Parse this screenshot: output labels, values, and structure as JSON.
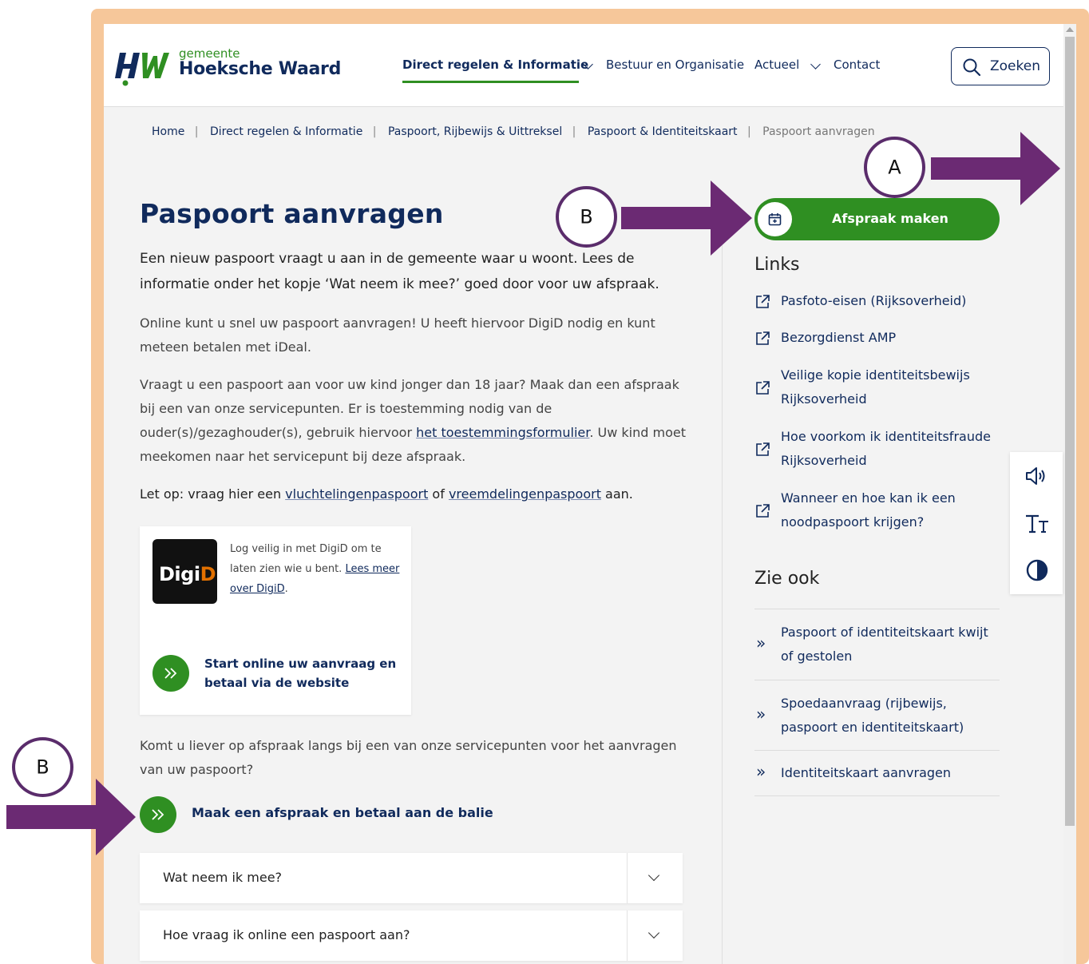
{
  "logo": {
    "small": "gemeente",
    "big": "Hoeksche Waard"
  },
  "nav": {
    "items": [
      {
        "label": "Direct regelen & Informatie"
      },
      {
        "label": "Bestuur en Organisatie"
      },
      {
        "label": "Actueel"
      },
      {
        "label": "Contact"
      }
    ],
    "search_label": "Zoeken"
  },
  "breadcrumb": [
    "Home",
    "Direct regelen & Informatie",
    "Paspoort, Rijbewijs & Uittreksel",
    "Paspoort & Identiteitskaart",
    "Paspoort aanvragen"
  ],
  "page_title": "Paspoort aanvragen",
  "intro": "Een nieuw paspoort vraagt u aan in de gemeente waar u woont. Lees de informatie onder het kopje ‘Wat neem ik mee?’ goed door voor uw afspraak.",
  "p1": "Online kunt u snel uw paspoort aanvragen! U heeft hiervoor DigiD nodig en kunt meteen betalen met iDeal.",
  "p2": {
    "before": "Vraagt u een paspoort aan voor uw kind jonger dan 18 jaar? Maak dan een afspraak bij een van onze servicepunten. Er is toestemming nodig van de ouder(s)/gezaghouder(s), gebruik hiervoor ",
    "link": "het toestemmingsformulier",
    "after": ". Uw kind moet meekomen naar het servicepunt bij deze afspraak."
  },
  "p3": {
    "before": "Let op: vraag hier een ",
    "link1": "vluchtelingenpaspoort",
    "mid": " of ",
    "link2": "vreemdelingenpaspoort",
    "after": " aan."
  },
  "digid": {
    "logo_a": "Digi",
    "logo_b": "D",
    "text": "Log veilig in met DigiD om te laten zien wie u bent. ",
    "link": "Lees meer over DigiD",
    "text_end": ".",
    "start": "Start online uw aanvraag en betaal via de website"
  },
  "p4": "Komt u liever op afspraak langs bij een van onze servicepunten voor het aanvragen van uw paspoort?",
  "afspraak_link": "Maak een afspraak en betaal aan de balie",
  "accordions": [
    "Wat neem ik mee?",
    "Hoe vraag ik online een paspoort aan?"
  ],
  "sidebar": {
    "button": "Afspraak maken",
    "links_heading": "Links",
    "links": [
      [
        "Pasfoto-eisen (Rijksoverheid)"
      ],
      [
        "Bezorgdienst AMP"
      ],
      [
        "Veilige kopie identiteitsbewijs",
        "Rijksoverheid"
      ],
      [
        "Hoe voorkom ik identiteitsfraude",
        "Rijksoverheid"
      ],
      [
        "Wanneer en hoe kan ik een",
        "noodpaspoort krijgen?"
      ]
    ],
    "see_heading": "Zie ook",
    "see": [
      [
        "Paspoort of identiteitskaart kwijt",
        "of gestolen"
      ],
      [
        "Spoedaanvraag (rijbewijs,",
        "paspoort en identiteitskaart)"
      ],
      [
        "Identiteitskaart aanvragen"
      ]
    ]
  },
  "annotations": {
    "a": "A",
    "b": "B"
  },
  "colors": {
    "brand_blue": "#102a5c",
    "brand_green": "#2f8f22",
    "frame": "#f6c79a",
    "annotation": "#6b2a73"
  }
}
